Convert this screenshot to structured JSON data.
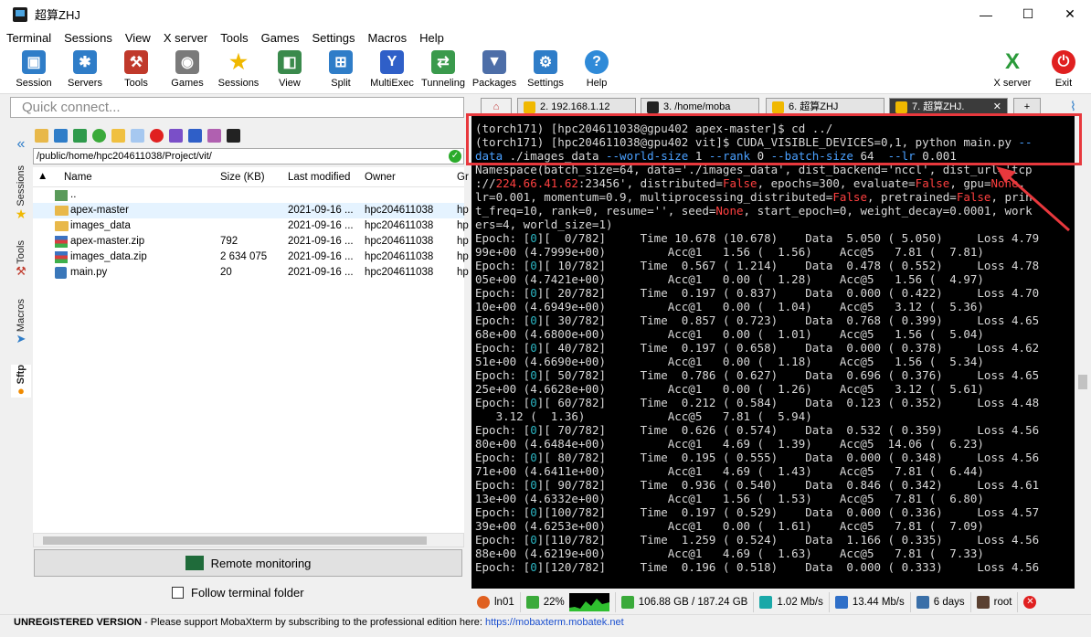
{
  "window": {
    "title": "超算ZHJ",
    "minimize": "—",
    "maximize": "☐",
    "close": "✕"
  },
  "menu": [
    "Terminal",
    "Sessions",
    "View",
    "X server",
    "Tools",
    "Games",
    "Settings",
    "Macros",
    "Help"
  ],
  "toolbar": {
    "items": [
      {
        "label": "Session",
        "icon": "session-icon",
        "color": "#2f7dc8"
      },
      {
        "label": "Servers",
        "icon": "servers-icon",
        "color": "#2f7dc8"
      },
      {
        "label": "Tools",
        "icon": "tools-icon",
        "color": "#c0392b"
      },
      {
        "label": "Games",
        "icon": "games-icon",
        "color": "#7a7a7a"
      },
      {
        "label": "Sessions",
        "icon": "star-icon",
        "color": "#f0b800"
      },
      {
        "label": "View",
        "icon": "view-icon",
        "color": "#3a8a4c"
      },
      {
        "label": "Split",
        "icon": "split-icon",
        "color": "#2f7dc8"
      },
      {
        "label": "MultiExec",
        "icon": "multiexec-icon",
        "color": "#2f5fc8"
      },
      {
        "label": "Tunneling",
        "icon": "tunneling-icon",
        "color": "#3a9a4c"
      },
      {
        "label": "Packages",
        "icon": "packages-icon",
        "color": "#4d6ea8"
      },
      {
        "label": "Settings",
        "icon": "settings-icon",
        "color": "#2f7dc8"
      },
      {
        "label": "Help",
        "icon": "help-icon",
        "color": "#2f8ad8"
      },
      {
        "label": "X server",
        "icon": "xserver-icon",
        "color": "#2a9a3a"
      },
      {
        "label": "Exit",
        "icon": "exit-icon",
        "color": "#e02020"
      }
    ]
  },
  "quick_connect": {
    "placeholder": "Quick connect..."
  },
  "sidetabs": [
    "Sessions",
    "Tools",
    "Macros",
    "Sftp"
  ],
  "sftp": {
    "path": "/public/home/hpc204611038/Project/vit/",
    "columns": [
      "Name",
      "Size (KB)",
      "Last modified",
      "Owner",
      "Gr"
    ],
    "rows": [
      {
        "name": "..",
        "size": "",
        "modified": "",
        "owner": "",
        "group": "",
        "type": "up"
      },
      {
        "name": "apex-master",
        "size": "",
        "modified": "2021-09-16 ...",
        "owner": "hpc204611038",
        "group": "hp",
        "type": "folder"
      },
      {
        "name": "images_data",
        "size": "",
        "modified": "2021-09-16 ...",
        "owner": "hpc204611038",
        "group": "hp",
        "type": "folder"
      },
      {
        "name": "apex-master.zip",
        "size": "792",
        "modified": "2021-09-16 ...",
        "owner": "hpc204611038",
        "group": "hp",
        "type": "zip"
      },
      {
        "name": "images_data.zip",
        "size": "2 634 075",
        "modified": "2021-09-16 ...",
        "owner": "hpc204611038",
        "group": "hp",
        "type": "zip"
      },
      {
        "name": "main.py",
        "size": "20",
        "modified": "2021-09-16 ...",
        "owner": "hpc204611038",
        "group": "hp",
        "type": "py"
      }
    ],
    "remote_monitoring": "Remote monitoring",
    "follow_terminal": "Follow terminal folder"
  },
  "tabs": [
    {
      "label": "2. 192.168.1.12"
    },
    {
      "label": "3. /home/moba"
    },
    {
      "label": "6. 超算ZHJ"
    },
    {
      "label": "7. 超算ZHJ."
    }
  ],
  "terminal": {
    "lines": [
      [
        {
          "t": "(torch171) [hpc204611038@gpu402 apex-master]$ cd ../"
        }
      ],
      [
        {
          "t": "(torch171) [hpc204611038@gpu402 vit]$ CUDA_VISIBLE_DEVICES=0,1, python main.py "
        },
        {
          "t": "--",
          "c": "b"
        }
      ],
      [
        {
          "t": "data",
          "c": "b"
        },
        {
          "t": " ./images_data "
        },
        {
          "t": "--world-size",
          "c": "b"
        },
        {
          "t": " 1 "
        },
        {
          "t": "--rank",
          "c": "b"
        },
        {
          "t": " 0 "
        },
        {
          "t": "--batch-size",
          "c": "b"
        },
        {
          "t": " 64  "
        },
        {
          "t": "--lr",
          "c": "b"
        },
        {
          "t": " 0.001"
        }
      ],
      [
        {
          "t": "Namespace(batch_size=64, data='./images_data', dist_backend='nccl', dist_url='tcp"
        }
      ],
      [
        {
          "t": "://"
        },
        {
          "t": "224.66.41.62",
          "c": "r"
        },
        {
          "t": ":23456', distributed="
        },
        {
          "t": "False",
          "c": "r"
        },
        {
          "t": ", epochs=300, evaluate="
        },
        {
          "t": "False",
          "c": "r"
        },
        {
          "t": ", gpu="
        },
        {
          "t": "None",
          "c": "r"
        },
        {
          "t": ","
        }
      ],
      [
        {
          "t": "lr=0.001, momentum=0.9, multiprocessing_distributed="
        },
        {
          "t": "False",
          "c": "r"
        },
        {
          "t": ", pretrained="
        },
        {
          "t": "False",
          "c": "r"
        },
        {
          "t": ", prin"
        }
      ],
      [
        {
          "t": "t_freq=10, rank=0, resume='', seed="
        },
        {
          "t": "None",
          "c": "r"
        },
        {
          "t": ", start_epoch=0, weight_decay=0.0001, work"
        }
      ],
      [
        {
          "t": "ers=4, world_size=1)"
        }
      ],
      [
        {
          "t": "Epoch: ["
        },
        {
          "t": "0",
          "c": "c"
        },
        {
          "t": "][  0/782]     Time 10.678 (10.678)    Data  5.050 ( 5.050)     Loss 4.79"
        }
      ],
      [
        {
          "t": "99e+00 (4.7999e+00)         Acc@1   1.56 (  1.56)    Acc@5   7.81 (  7.81)"
        }
      ],
      [
        {
          "t": "Epoch: ["
        },
        {
          "t": "0",
          "c": "c"
        },
        {
          "t": "][ 10/782]     Time  0.567 ( 1.214)    Data  0.478 ( 0.552)     Loss 4.78"
        }
      ],
      [
        {
          "t": "05e+00 (4.7421e+00)         Acc@1   0.00 (  1.28)    Acc@5   1.56 (  4.97)"
        }
      ],
      [
        {
          "t": "Epoch: ["
        },
        {
          "t": "0",
          "c": "c"
        },
        {
          "t": "][ 20/782]     Time  0.197 ( 0.837)    Data  0.000 ( 0.422)     Loss 4.70"
        }
      ],
      [
        {
          "t": "10e+00 (4.6949e+00)         Acc@1   0.00 (  1.04)    Acc@5   3.12 (  5.36)"
        }
      ],
      [
        {
          "t": "Epoch: ["
        },
        {
          "t": "0",
          "c": "c"
        },
        {
          "t": "][ 30/782]     Time  0.857 ( 0.723)    Data  0.768 ( 0.399)     Loss 4.65"
        }
      ],
      [
        {
          "t": "68e+00 (4.6800e+00)         Acc@1   0.00 (  1.01)    Acc@5   1.56 (  5.04)"
        }
      ],
      [
        {
          "t": "Epoch: ["
        },
        {
          "t": "0",
          "c": "c"
        },
        {
          "t": "][ 40/782]     Time  0.197 ( 0.658)    Data  0.000 ( 0.378)     Loss 4.62"
        }
      ],
      [
        {
          "t": "51e+00 (4.6690e+00)         Acc@1   0.00 (  1.18)    Acc@5   1.56 (  5.34)"
        }
      ],
      [
        {
          "t": "Epoch: ["
        },
        {
          "t": "0",
          "c": "c"
        },
        {
          "t": "][ 50/782]     Time  0.786 ( 0.627)    Data  0.696 ( 0.376)     Loss 4.65"
        }
      ],
      [
        {
          "t": "25e+00 (4.6628e+00)         Acc@1   0.00 (  1.26)    Acc@5   3.12 (  5.61)"
        }
      ],
      [
        {
          "t": "Epoch: ["
        },
        {
          "t": "0",
          "c": "c"
        },
        {
          "t": "][ 60/782]     Time  0.212 ( 0.584)    Data  0.123 ( 0.352)     Loss 4.48"
        }
      ],
      [
        {
          "t": "   3.12 (  1.36)            Acc@5   7.81 (  5.94)"
        }
      ],
      [
        {
          "t": "Epoch: ["
        },
        {
          "t": "0",
          "c": "c"
        },
        {
          "t": "][ 70/782]     Time  0.626 ( 0.574)    Data  0.532 ( 0.359)     Loss 4.56"
        }
      ],
      [
        {
          "t": "80e+00 (4.6484e+00)         Acc@1   4.69 (  1.39)    Acc@5  14.06 (  6.23)"
        }
      ],
      [
        {
          "t": "Epoch: ["
        },
        {
          "t": "0",
          "c": "c"
        },
        {
          "t": "][ 80/782]     Time  0.195 ( 0.555)    Data  0.000 ( 0.348)     Loss 4.56"
        }
      ],
      [
        {
          "t": "71e+00 (4.6411e+00)         Acc@1   4.69 (  1.43)    Acc@5   7.81 (  6.44)"
        }
      ],
      [
        {
          "t": "Epoch: ["
        },
        {
          "t": "0",
          "c": "c"
        },
        {
          "t": "][ 90/782]     Time  0.936 ( 0.540)    Data  0.846 ( 0.342)     Loss 4.61"
        }
      ],
      [
        {
          "t": "13e+00 (4.6332e+00)         Acc@1   1.56 (  1.53)    Acc@5   7.81 (  6.80)"
        }
      ],
      [
        {
          "t": "Epoch: ["
        },
        {
          "t": "0",
          "c": "c"
        },
        {
          "t": "][100/782]     Time  0.197 ( 0.529)    Data  0.000 ( 0.336)     Loss 4.57"
        }
      ],
      [
        {
          "t": "39e+00 (4.6253e+00)         Acc@1   0.00 (  1.61)    Acc@5   7.81 (  7.09)"
        }
      ],
      [
        {
          "t": "Epoch: ["
        },
        {
          "t": "0",
          "c": "c"
        },
        {
          "t": "][110/782]     Time  1.259 ( 0.524)    Data  1.166 ( 0.335)     Loss 4.56"
        }
      ],
      [
        {
          "t": "88e+00 (4.6219e+00)         Acc@1   4.69 (  1.63)    Acc@5   7.81 (  7.33)"
        }
      ],
      [
        {
          "t": "Epoch: ["
        },
        {
          "t": "0",
          "c": "c"
        },
        {
          "t": "][120/782]     Time  0.196 ( 0.518)    Data  0.000 ( 0.333)     Loss 4.56"
        }
      ]
    ]
  },
  "status": {
    "host": "ln01",
    "cpu": "22%",
    "disk": "106.88 GB / 187.24 GB",
    "upload": "1.02 Mb/s",
    "download": "13.44 Mb/s",
    "uptime": "6 days",
    "user": "root"
  },
  "bottom": {
    "version": "UNREGISTERED VERSION",
    "message": "  -  Please support MobaXterm by subscribing to the professional edition here:",
    "link": "https://mobaxterm.mobatek.net"
  }
}
